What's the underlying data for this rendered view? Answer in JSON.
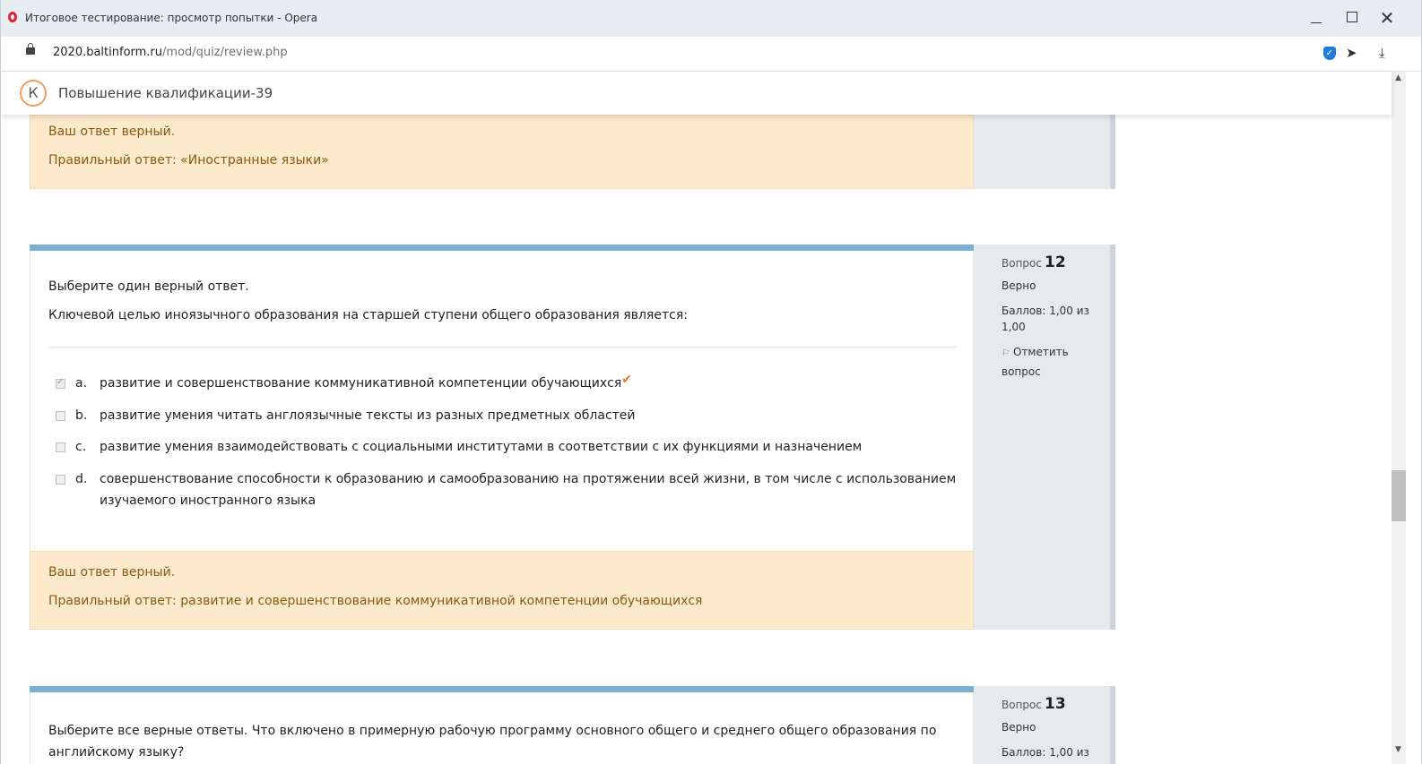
{
  "browser": {
    "window_title": "Итоговое тестирование: просмотр попытки - Opera",
    "url_host": "2020.baltinform.ru",
    "url_path": "/mod/quiz/review.php",
    "close_glyph": "✕"
  },
  "site": {
    "name": "Повышение квалификации-39",
    "logo_glyph": "К"
  },
  "prev_feedback": {
    "status": "Ваш ответ верный.",
    "correct": "Правильный ответ: «Иностранные языки»"
  },
  "q12": {
    "label": "Вопрос",
    "number": "12",
    "state": "Верно",
    "grade": "Баллов: 1,00 из 1,00",
    "flag": "Отметить вопрос",
    "instruction": "Выберите один верный ответ.",
    "question": "Ключевой целью иноязычного образования на старшей ступени общего образования является:",
    "options": [
      {
        "letter": "a.",
        "text": "развитие и совершенствование коммуникативной компетенции обучающихся",
        "checked": true
      },
      {
        "letter": "b.",
        "text": "развитие умения читать англоязычные тексты из разных предметных областей",
        "checked": false
      },
      {
        "letter": "c.",
        "text": "развитие умения взаимодействовать с социальными институтами в соответствии с их функциями и назначением",
        "checked": false
      },
      {
        "letter": "d.",
        "text": "совершенствование способности к образованию и самообразованию на протяжении всей жизни, в том числе с использованием изучаемого иностранного языка",
        "checked": false
      }
    ],
    "feedback_status": "Ваш ответ верный.",
    "feedback_correct": "Правильный ответ: развитие и совершенствование коммуникативной компетенции обучающихся"
  },
  "q13": {
    "label": "Вопрос",
    "number": "13",
    "state": "Верно",
    "grade": "Баллов: 1,00 из",
    "question": "Выберите все верные ответы. Что включено в примерную рабочую программу основного общего и среднего общего образования по английскому языку?"
  },
  "colors": {
    "accent_bar": "#7bafd4",
    "feedback_bg": "#fde9cc",
    "feedback_text": "#8a5a0e",
    "correct_tick": "#f0731e"
  }
}
